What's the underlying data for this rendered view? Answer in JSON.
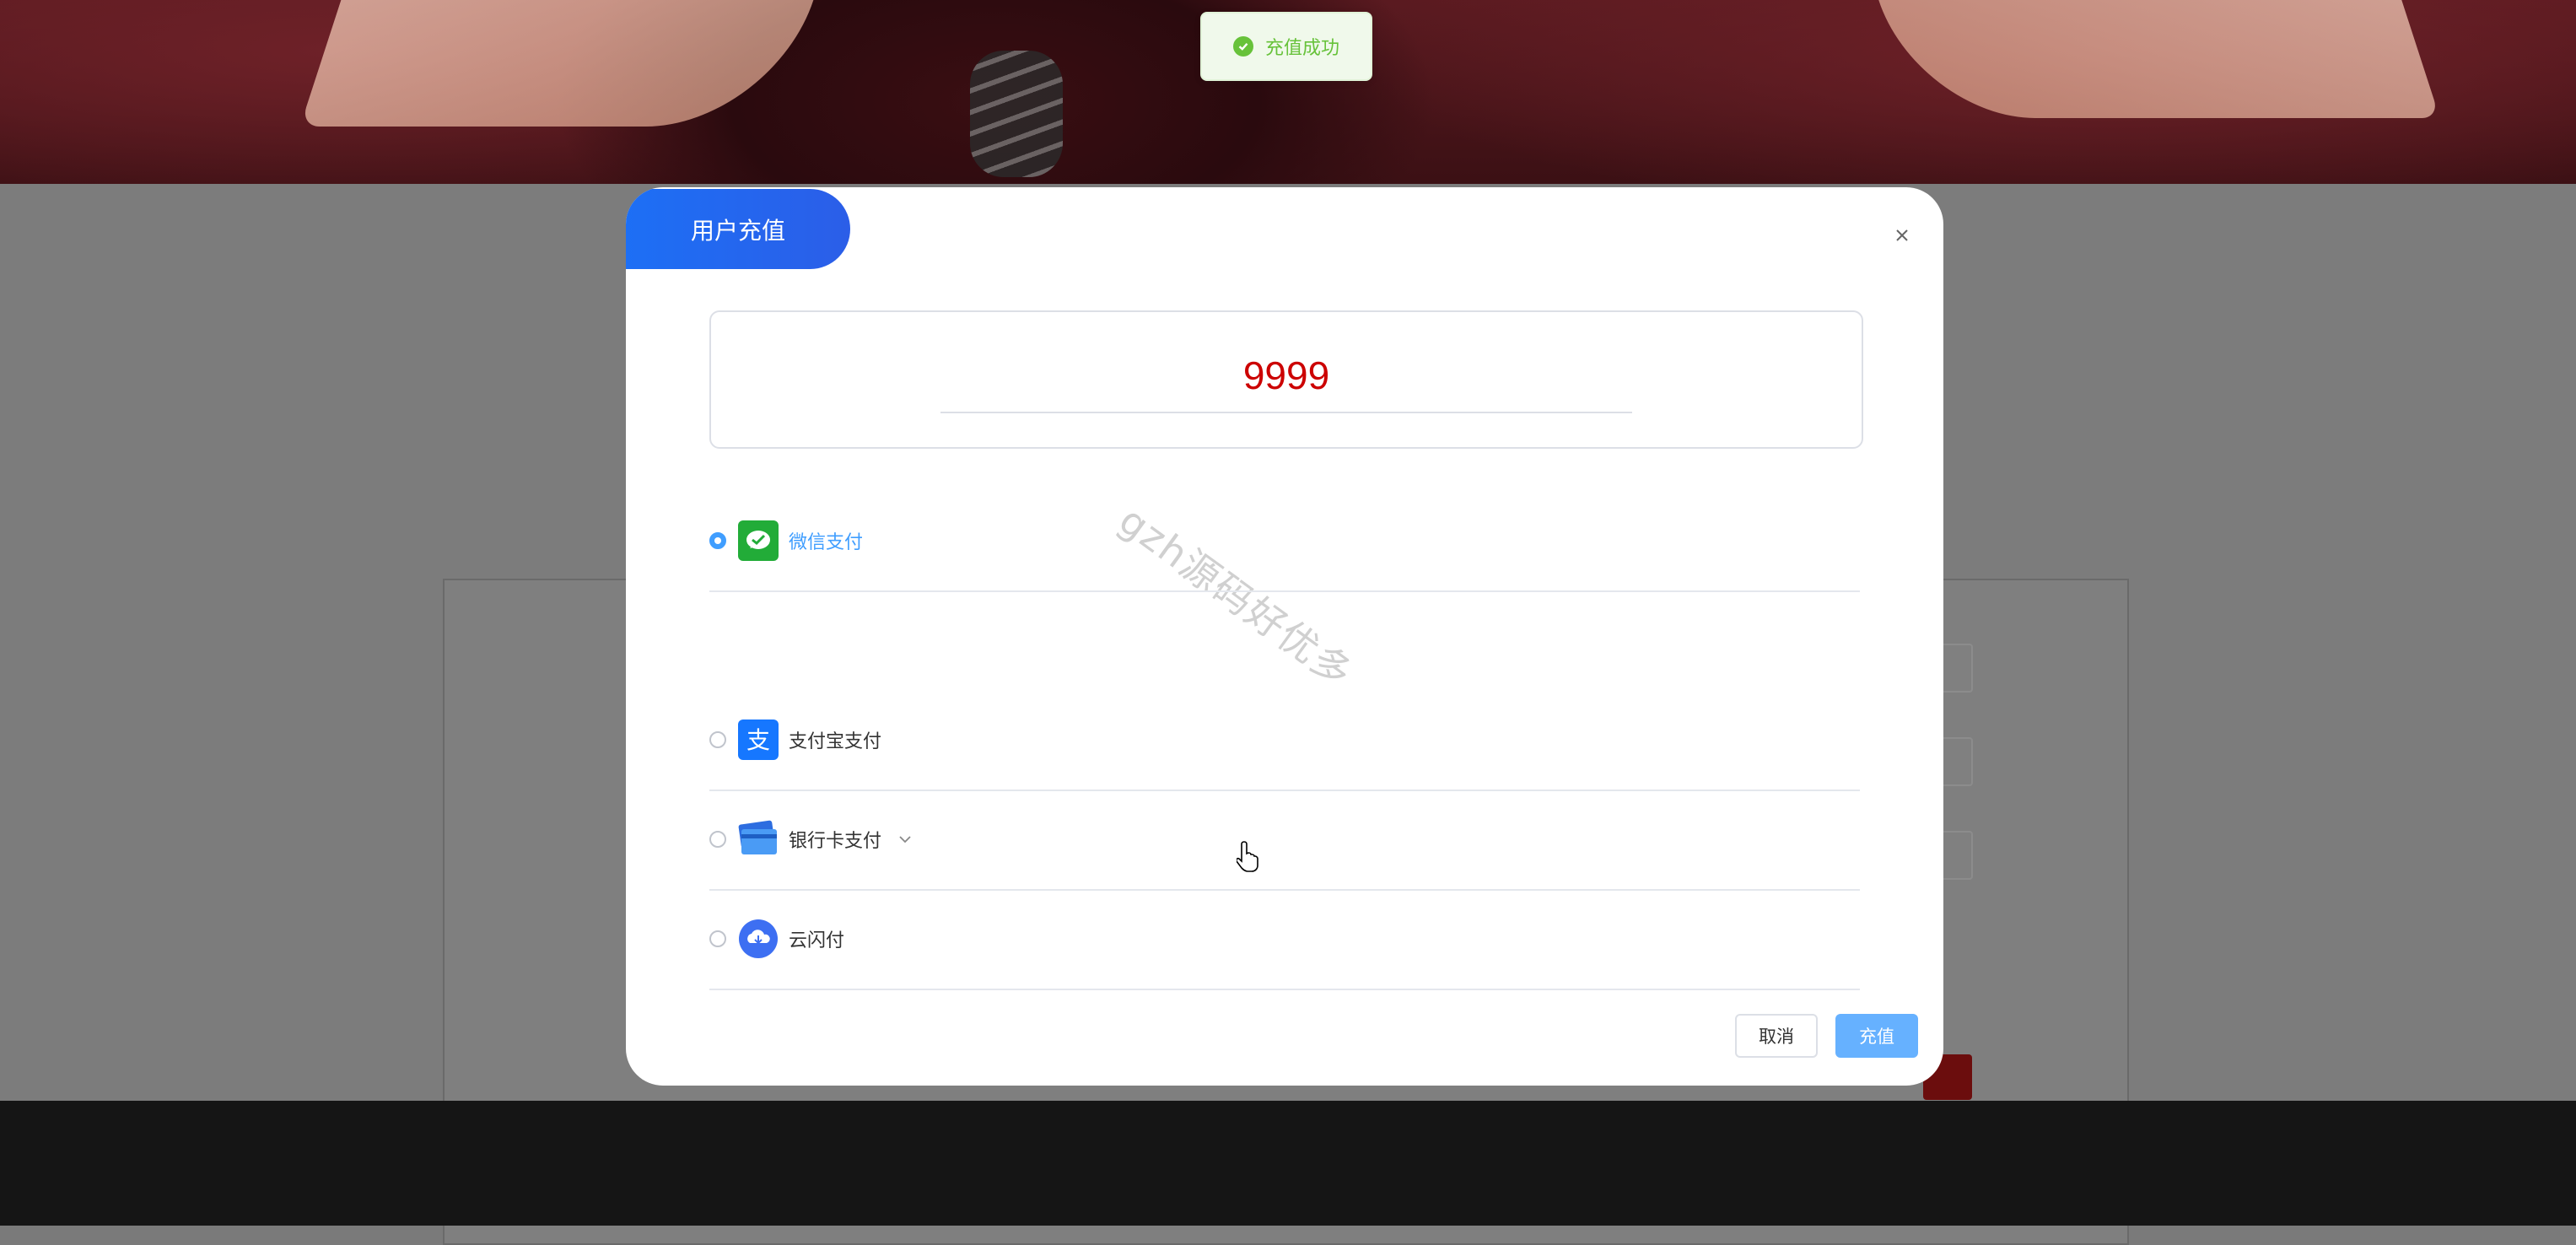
{
  "toast": {
    "text": "充值成功",
    "icon": "check-circle-icon",
    "color": "#67c23a"
  },
  "modal": {
    "title": "用户充值",
    "close_icon": "close-icon",
    "amount": "9999",
    "amount_color": "#cc0000",
    "payment_methods": [
      {
        "label": "微信支付",
        "icon": "wechat-pay-icon",
        "selected": true
      },
      {
        "label": "支付宝支付",
        "icon": "alipay-icon",
        "selected": false
      },
      {
        "label": "银行卡支付",
        "icon": "bank-card-icon",
        "selected": false,
        "has_dropdown": true
      },
      {
        "label": "云闪付",
        "icon": "unionpay-cloud-icon",
        "selected": false
      }
    ],
    "cancel_label": "取消",
    "confirm_label": "充值"
  },
  "watermark": "gzh源码好优多",
  "colors": {
    "primary": "#409eff",
    "tab_gradient_start": "#1d6ff5",
    "tab_gradient_end": "#2b5ee8"
  }
}
